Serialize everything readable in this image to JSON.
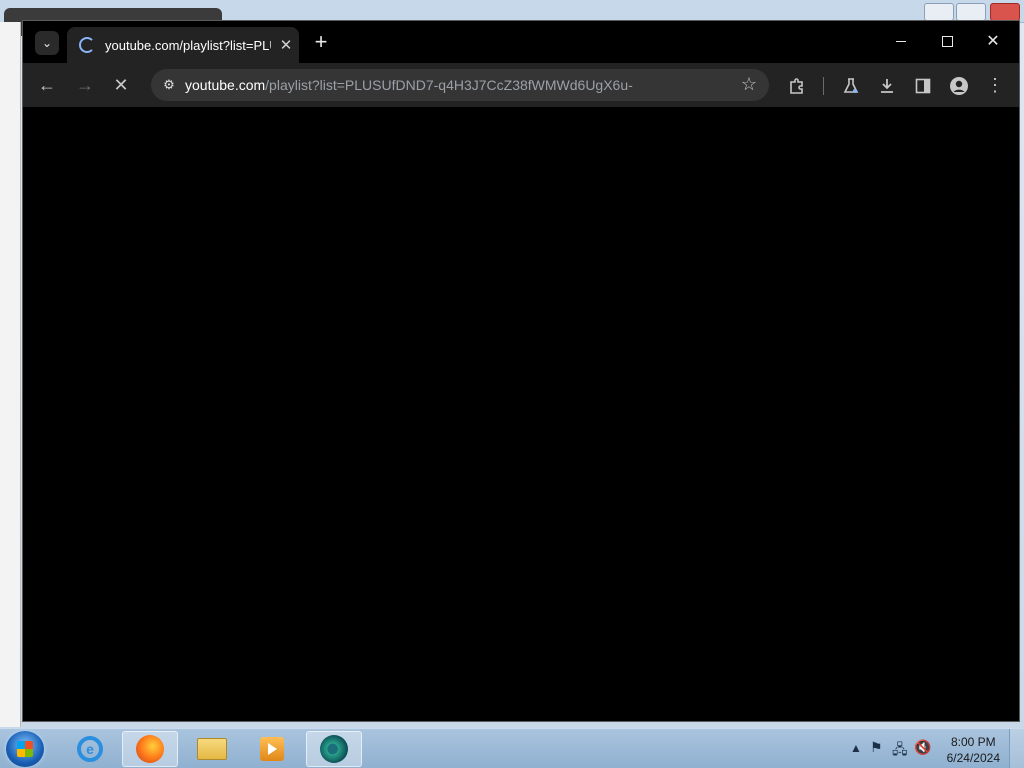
{
  "browser": {
    "tab": {
      "title": "youtube.com/playlist?list=PLU",
      "close_glyph": "✕"
    },
    "new_tab_glyph": "+",
    "window_controls": {
      "minimize_glyph": "—",
      "maximize_glyph": "☐",
      "close_glyph": "✕"
    },
    "address_bar": {
      "host": "youtube.com",
      "path": "/playlist?list=PLUSUfDND7-q4H3J7CcZ38fWMWd6UgX6u-"
    },
    "icons": {
      "back": "back-arrow-icon",
      "forward": "forward-arrow-icon",
      "stop": "stop-loading-icon",
      "site_info": "tune-icon",
      "bookmark": "star-icon",
      "extensions": "puzzle-icon",
      "labs": "flask-icon",
      "downloads": "download-icon",
      "side_panel": "side-panel-icon",
      "profile": "profile-icon",
      "menu": "kebab-menu-icon"
    }
  },
  "taskbar": {
    "clock": {
      "time": "8:00 PM",
      "date": "6/24/2024"
    },
    "apps": [
      "internet-explorer",
      "firefox",
      "file-explorer",
      "media-player",
      "chrome-dev"
    ]
  }
}
